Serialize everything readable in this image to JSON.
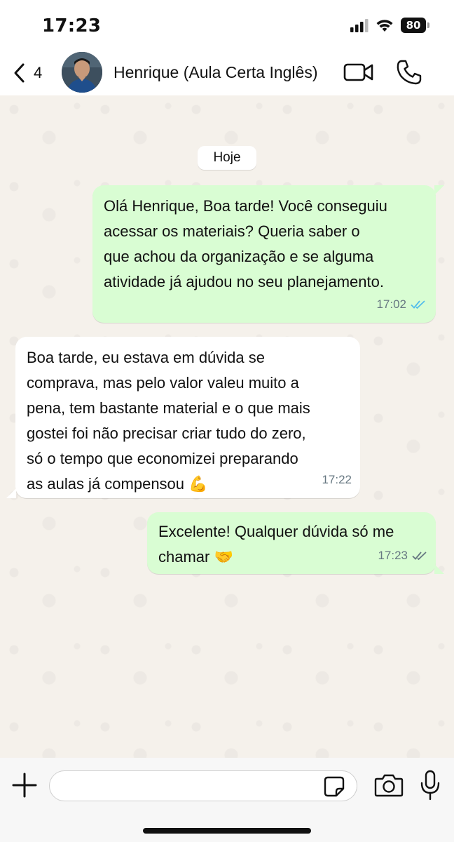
{
  "status_bar": {
    "time": "17:23",
    "battery": "80",
    "icons": [
      "signal-icon",
      "wifi-icon",
      "battery-icon"
    ]
  },
  "header": {
    "back_count": "4",
    "contact_name": "Henrique (Aula Certa Inglês)",
    "icons": [
      "back-chevron-icon",
      "video-call-icon",
      "phone-icon"
    ]
  },
  "chat": {
    "date_label": "Hoje",
    "messages": [
      {
        "direction": "out",
        "text": "Olá Henrique, Boa tarde! Você conseguiu\nacessar os materiais? Queria saber o\nque achou da organização e se alguma\natividade já ajudou no seu planejamento.",
        "time": "17:02",
        "status": "read"
      },
      {
        "direction": "in",
        "text": "Boa tarde, eu estava em dúvida se\ncomprava, mas pelo valor valeu muito a\npena, tem bastante material e o que mais\ngostei foi não precisar criar tudo do zero,\nsó o tempo que economizei preparando\nas aulas já compensou",
        "emoji": "💪",
        "time": "17:22"
      },
      {
        "direction": "out",
        "text": "Excelente! Qualquer dúvida só me\nchamar",
        "emoji": "🤝",
        "time": "17:23",
        "status": "delivered"
      }
    ]
  },
  "composer": {
    "input_value": "",
    "placeholder": "",
    "icons": [
      "plus-icon",
      "sticker-icon",
      "camera-icon",
      "microphone-icon"
    ]
  },
  "colors": {
    "outgoing_bubble": "#d9fdd3",
    "incoming_bubble": "#ffffff",
    "read_ticks": "#53bdeb",
    "delivered_ticks": "#667781",
    "chat_background": "#f5f1eb"
  }
}
